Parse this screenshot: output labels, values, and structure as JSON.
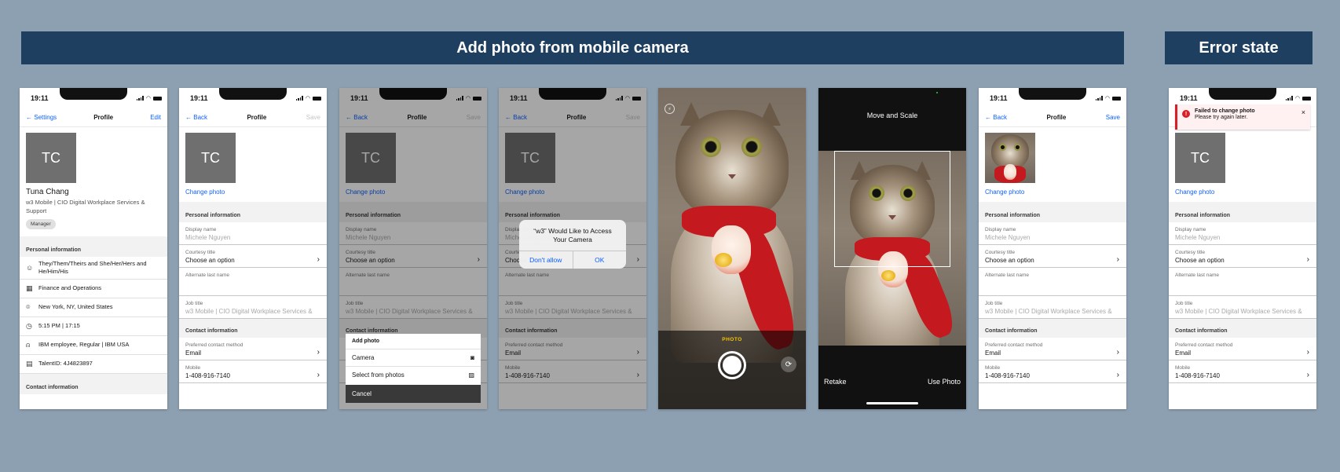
{
  "banners": {
    "main": "Add photo from mobile camera",
    "error": "Error state"
  },
  "status": {
    "time": "19:11"
  },
  "screen1": {
    "back": "Settings",
    "title": "Profile",
    "action": "Edit",
    "initials": "TC",
    "name": "Tuna Chang",
    "org": "w3 Mobile | CIO Digital Workplace Services & Support",
    "tag": "Manager",
    "section": "Personal information",
    "rows": [
      {
        "icon": "pronouns-icon",
        "glyph": "☺",
        "text": "They/Them/Theirs and She/Her/Hers and He/Him/His"
      },
      {
        "icon": "building-icon",
        "glyph": "▦",
        "text": "Finance and Operations"
      },
      {
        "icon": "location-icon",
        "glyph": "⌾",
        "text": "New York, NY, United States"
      },
      {
        "icon": "clock-icon",
        "glyph": "◷",
        "text": "5:15 PM | 17:15"
      },
      {
        "icon": "person-icon",
        "glyph": "⍝",
        "text": "IBM employee, Regular | IBM USA"
      },
      {
        "icon": "id-card-icon",
        "glyph": "▤",
        "text": "TalentID: 4J4823897"
      }
    ],
    "section2": "Contact information"
  },
  "edit": {
    "back": "Back",
    "title": "Profile",
    "save": "Save",
    "initials": "TC",
    "change_photo": "Change photo",
    "personal_section": "Personal information",
    "display_name_label": "Display name",
    "display_name_value": "Michele Nguyen",
    "courtesy_label": "Courtesy title",
    "courtesy_value": "Choose an option",
    "alt_last_label": "Alternate last name",
    "job_label": "Job title",
    "job_value": "w3 Mobile | CIO Digital Workplace Services &",
    "contact_section": "Contact information",
    "pref_label": "Preferred contact method",
    "pref_value": "Email",
    "mobile_label": "Mobile",
    "mobile_value": "1-408-916-7140"
  },
  "sheet": {
    "title": "Add photo",
    "camera": "Camera",
    "library": "Select from photos",
    "cancel": "Cancel"
  },
  "alert": {
    "message": "“w3” Would Like to Access Your Camera",
    "deny": "Don't allow",
    "ok": "OK"
  },
  "camera": {
    "mode": "PHOTO"
  },
  "crop": {
    "title": "Move and Scale",
    "retake": "Retake",
    "use": "Use Photo"
  },
  "toast": {
    "title": "Failed to change photo",
    "subtitle": "Please try again later."
  }
}
